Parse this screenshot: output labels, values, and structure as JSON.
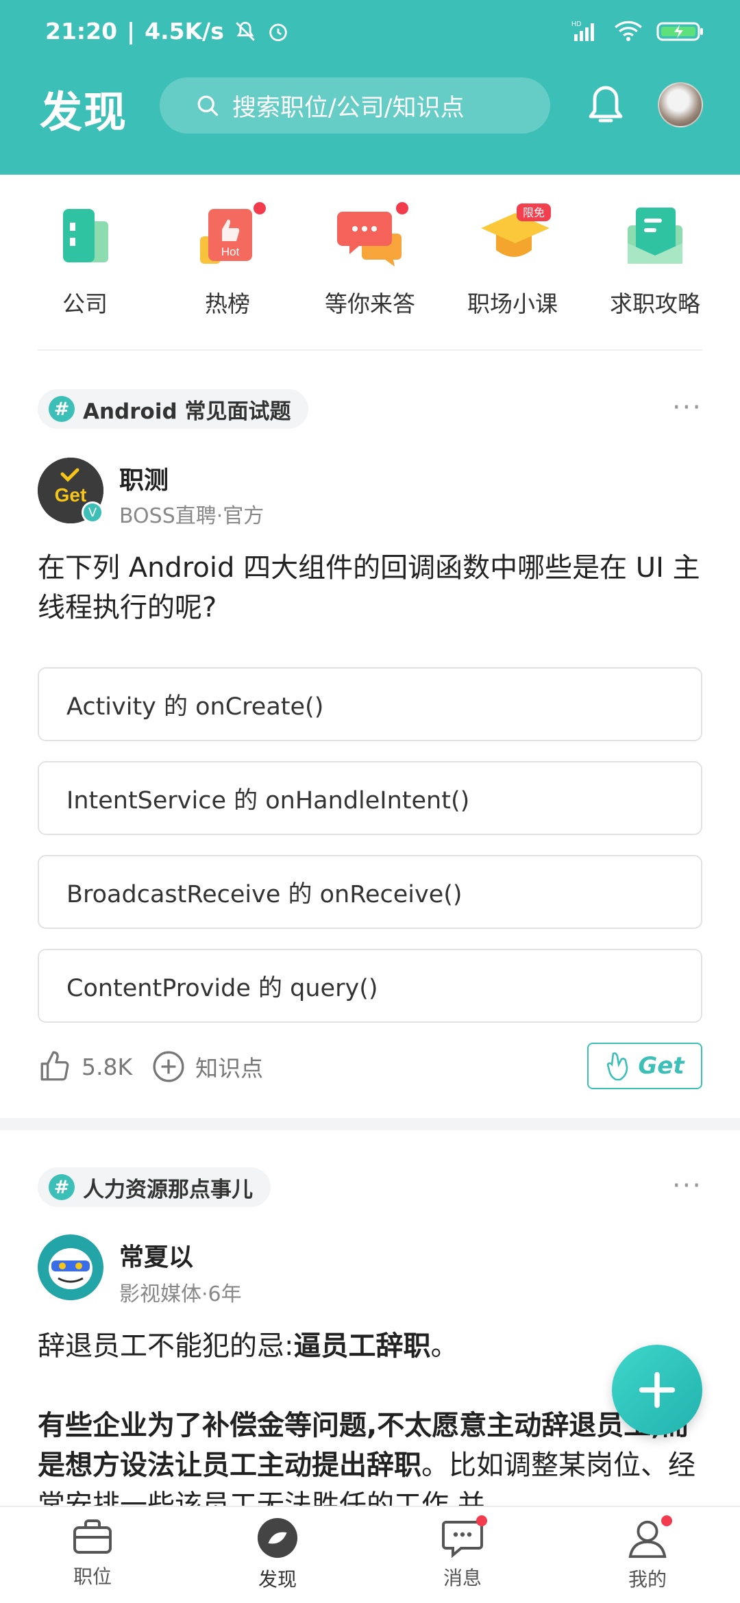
{
  "status_bar": {
    "time": "21:20",
    "network_speed": "4.5K/s",
    "icons": [
      "mute-icon",
      "alarm-icon",
      "hd-signal-icon",
      "wifi-icon",
      "battery-charging-icon"
    ]
  },
  "header": {
    "title": "发现",
    "search_placeholder": "搜索职位/公司/知识点"
  },
  "quick_nav": [
    {
      "label": "公司",
      "icon": "company-building-icon",
      "dot": false
    },
    {
      "label": "热榜",
      "icon": "hot-list-icon",
      "badge_text": "Hot",
      "dot": true
    },
    {
      "label": "等你来答",
      "icon": "chat-answer-icon",
      "dot": true
    },
    {
      "label": "职场小课",
      "icon": "graduation-cap-icon",
      "badge_text": "限免",
      "dot": false
    },
    {
      "label": "求职攻略",
      "icon": "guide-book-icon",
      "dot": false
    }
  ],
  "card1": {
    "topic": "Android 常见面试题",
    "author_name": "职测",
    "author_meta": "BOSS直聘·官方",
    "avatar_text": "Get",
    "verified": "V",
    "question": "在下列 Android 四大组件的回调函数中哪些是在 UI 主线程执行的呢?",
    "options": [
      "Activity 的 onCreate()",
      "IntentService 的 onHandleIntent()",
      "BroadcastReceive 的 onReceive()",
      "ContentProvide 的 query()"
    ],
    "like_count": "5.8K",
    "knowledge_label": "知识点",
    "get_label": "Get"
  },
  "card2": {
    "topic": "人力资源那点事儿",
    "author_name": "常夏以",
    "author_meta": "影视媒体·6年",
    "line1_normal": "辞退员工不能犯的忌:",
    "line1_bold": "逼员工辞职",
    "line1_end": "。",
    "para_bold": "有些企业为了补偿金等问题,不太愿意主动辞退员工,而是想方设法让员工主动提出辞职",
    "para_normal": "。比如调整某岗位、经常安排一些该员工无法胜任的工作,并"
  },
  "bottom_nav": [
    {
      "label": "职位",
      "icon": "briefcase-icon",
      "dot": false
    },
    {
      "label": "发现",
      "icon": "discover-icon",
      "dot": false,
      "active": true
    },
    {
      "label": "消息",
      "icon": "message-icon",
      "dot": true
    },
    {
      "label": "我的",
      "icon": "profile-icon",
      "dot": true
    }
  ],
  "colors": {
    "brand": "#3cbfb7",
    "badge_red": "#f23c4d"
  }
}
